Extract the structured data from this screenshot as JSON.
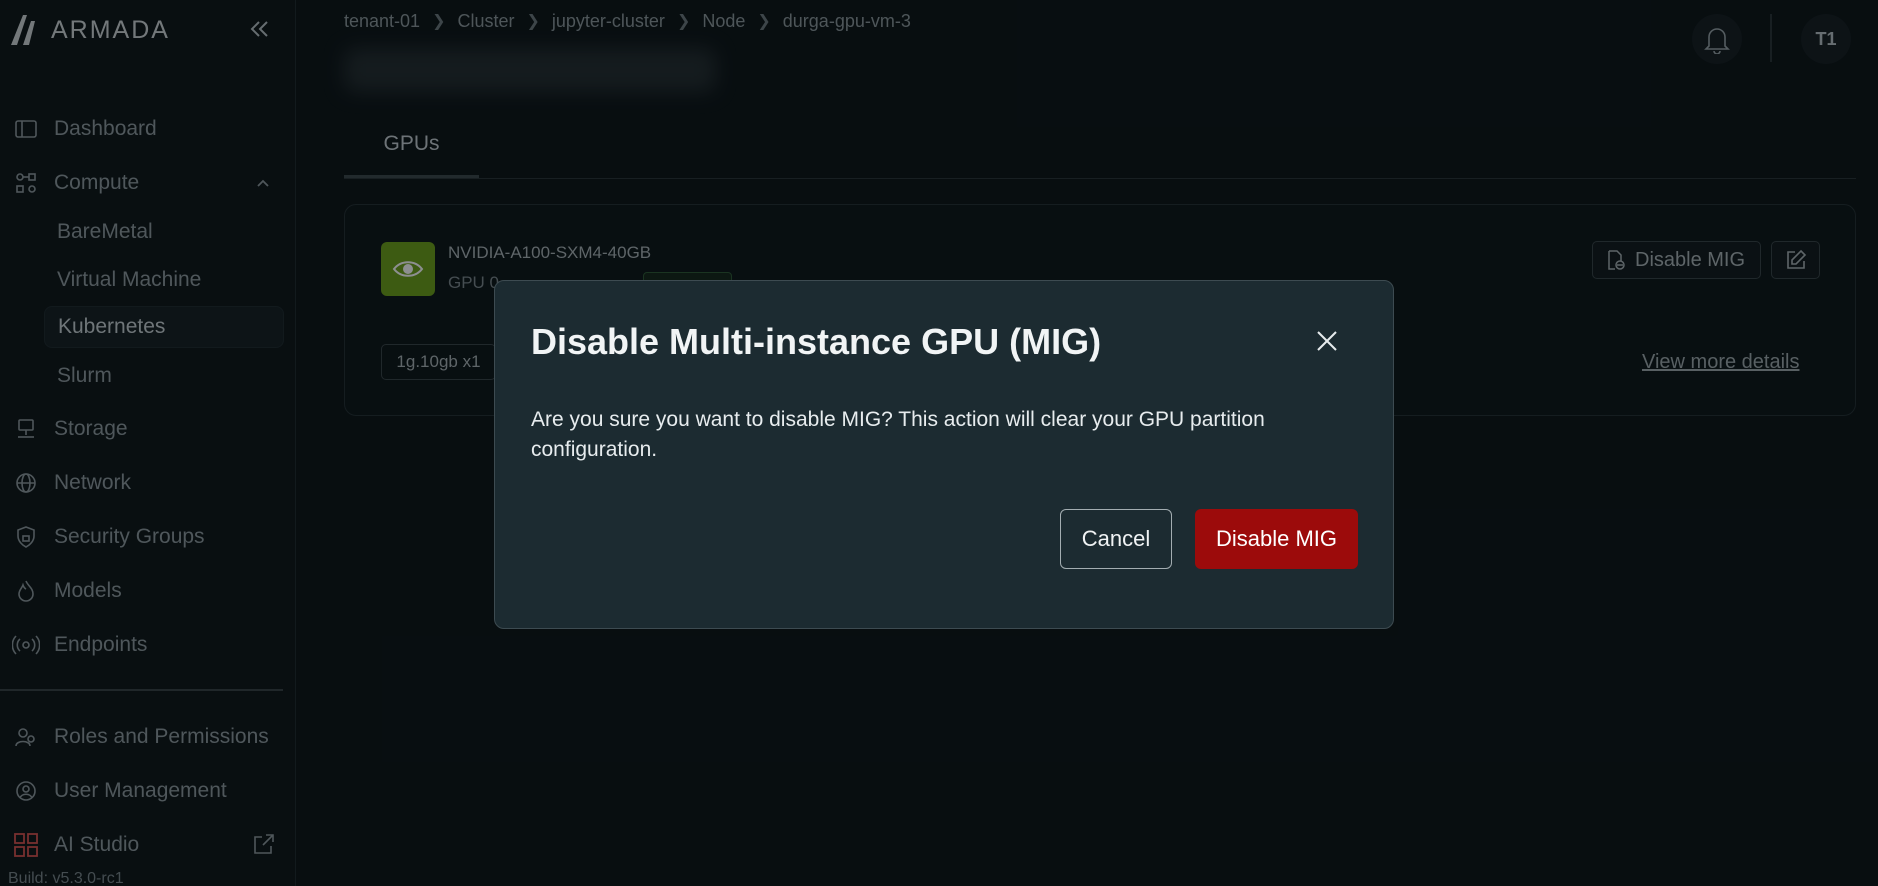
{
  "app": {
    "brand": "ARMADA",
    "build": "Build: v5.3.0-rc1"
  },
  "sidebar": {
    "items": [
      {
        "label": "Dashboard",
        "icon": "dashboard-icon"
      },
      {
        "label": "Compute",
        "icon": "compute-icon",
        "expanded": true,
        "children": [
          "BareMetal",
          "Virtual Machine",
          "Kubernetes",
          "Slurm"
        ],
        "active_child": "Kubernetes"
      },
      {
        "label": "Storage",
        "icon": "storage-icon"
      },
      {
        "label": "Network",
        "icon": "globe-icon"
      },
      {
        "label": "Security Groups",
        "icon": "lock-icon"
      },
      {
        "label": "Models",
        "icon": "flame-icon"
      },
      {
        "label": "Endpoints",
        "icon": "broadcast-icon"
      }
    ],
    "bottom_items": [
      {
        "label": "Roles and Permissions",
        "icon": "users-icon"
      },
      {
        "label": "User Management",
        "icon": "user-gear-icon"
      },
      {
        "label": "AI Studio",
        "icon": "grid-icon"
      }
    ]
  },
  "breadcrumb": [
    "tenant-01",
    "Cluster",
    "jupyter-cluster",
    "Node",
    "durga-gpu-vm-3"
  ],
  "header": {
    "avatar_initials": "T1"
  },
  "tabs": [
    {
      "label": "GPUs",
      "active": true
    }
  ],
  "gpu_card": {
    "name": "NVIDIA-A100-SXM4-40GB",
    "sub": "GPU 0",
    "partition": "1g.10gb x1",
    "disable_label": "Disable MIG",
    "view_more": "View more details"
  },
  "modal": {
    "title": "Disable Multi-instance GPU (MIG)",
    "body": "Are you sure you want to disable MIG? This action will clear your GPU partition configuration.",
    "cancel_label": "Cancel",
    "confirm_label": "Disable MIG",
    "confirm_color": "#9c0b0b"
  }
}
